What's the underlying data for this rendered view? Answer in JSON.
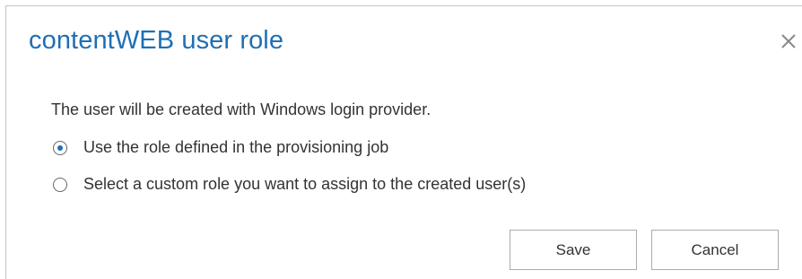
{
  "dialog": {
    "title": "contentWEB user role",
    "close_icon": "close-icon",
    "message": "The user will be created with Windows login provider.",
    "options": [
      {
        "label": "Use the role defined in the provisioning job",
        "selected": true
      },
      {
        "label": "Select a custom role you want to assign to the created user(s)",
        "selected": false
      }
    ],
    "buttons": {
      "save_label": "Save",
      "cancel_label": "Cancel"
    },
    "colors": {
      "title": "#1f6fb5",
      "text": "#333333",
      "radio_dot": "#1f6fb5"
    }
  }
}
